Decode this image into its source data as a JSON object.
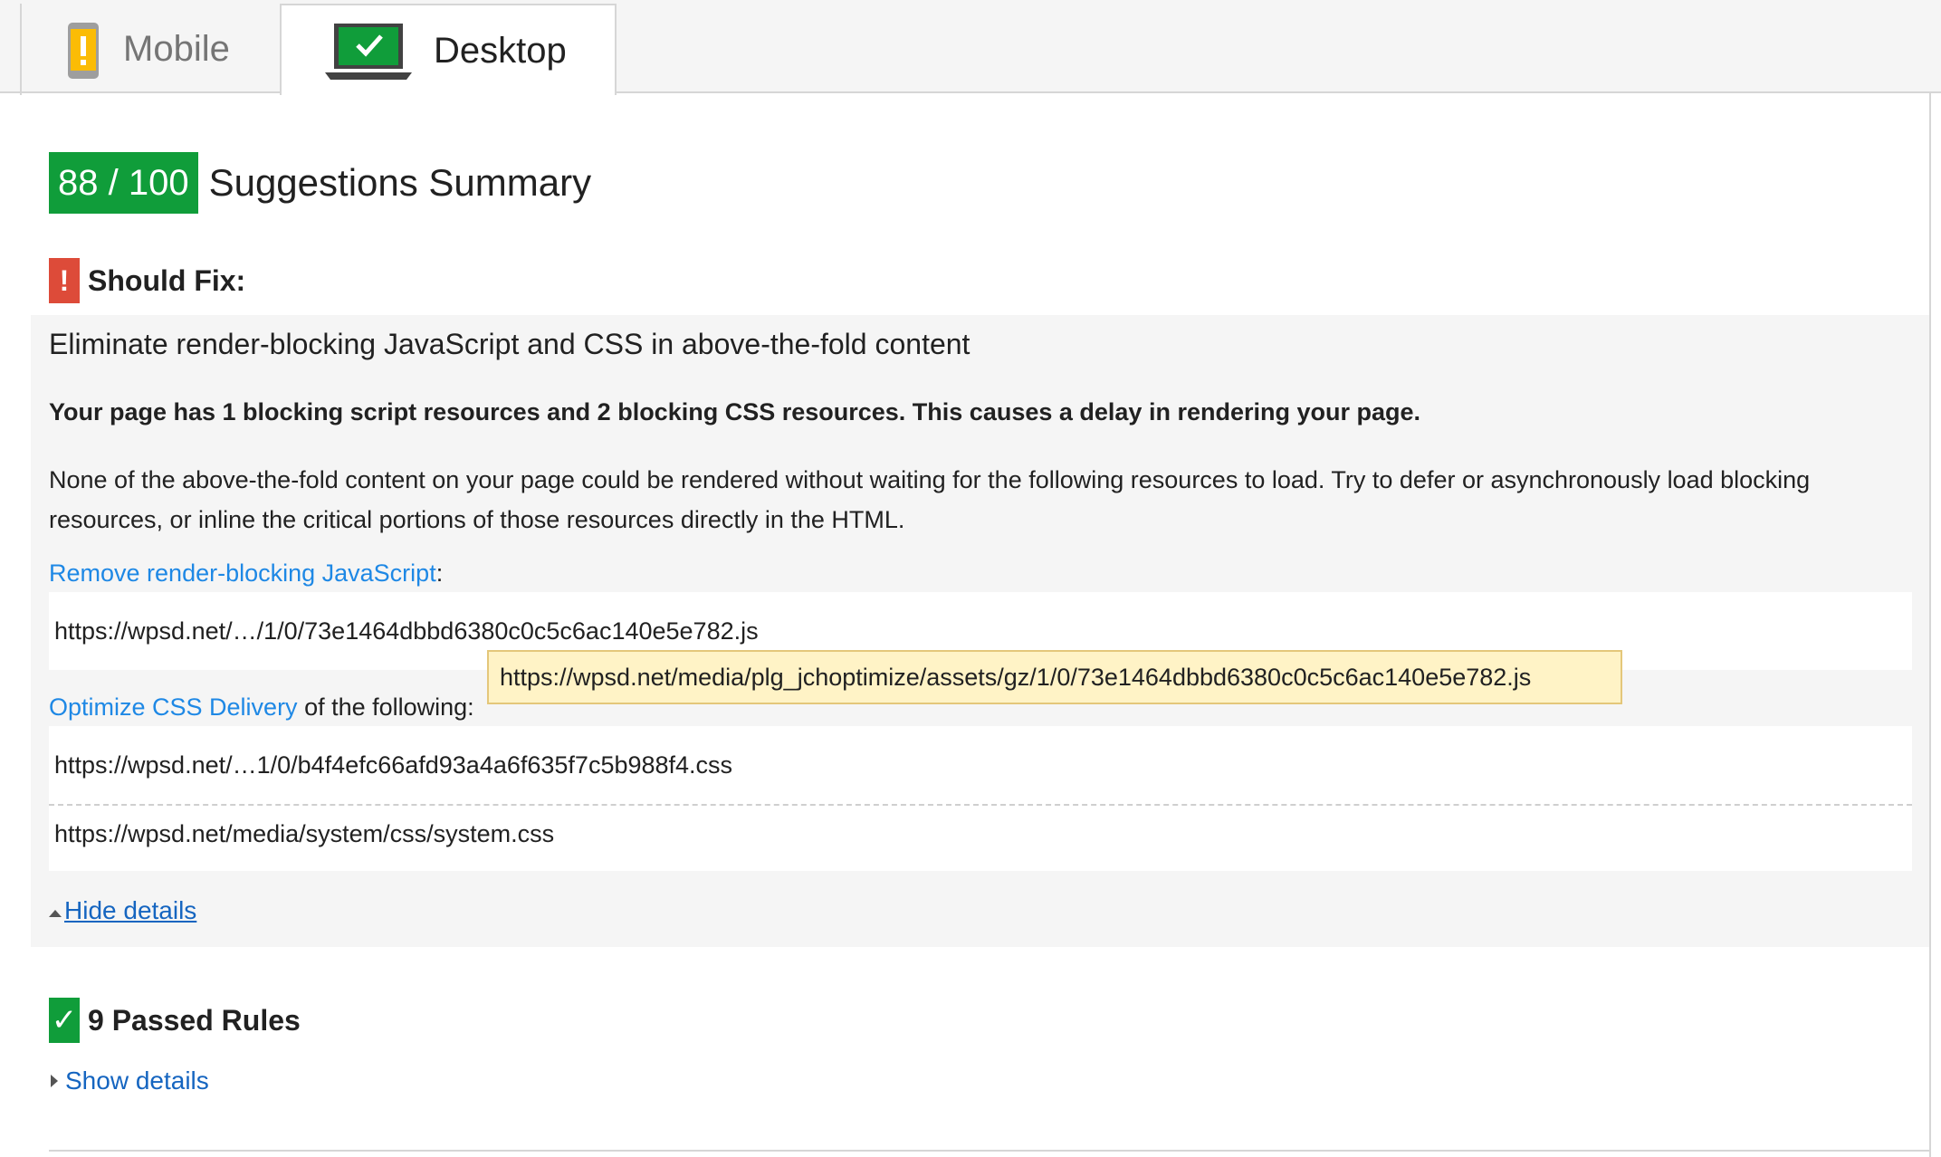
{
  "tabs": {
    "mobile_label": "Mobile",
    "desktop_label": "Desktop",
    "selected": "Desktop"
  },
  "summary": {
    "score": "88 / 100",
    "title": "Suggestions Summary"
  },
  "should_fix": {
    "icon_text": "!",
    "title": "Should Fix:",
    "rule": {
      "title": "Eliminate render-blocking JavaScript and CSS in above-the-fold content",
      "summary": "Your page has 1 blocking script resources and 2 blocking CSS resources. This causes a delay in rendering your page.",
      "description": "None of the above-the-fold content on your page could be rendered without waiting for the following resources to load. Try to defer or asynchronously load blocking resources, or inline the critical portions of those resources directly in the HTML.",
      "js_link": "Remove render-blocking JavaScript",
      "js_suffix": ":",
      "js_urls": [
        "https://wpsd.net/…/1/0/73e1464dbbd6380c0c5c6ac140e5e782.js"
      ],
      "css_link": "Optimize CSS Delivery",
      "css_suffix": " of the following:",
      "css_urls": [
        "https://wpsd.net/…1/0/b4f4efc66afd93a4a6f635f7c5b988f4.css",
        "https://wpsd.net/media/system/css/system.css"
      ],
      "tooltip": "https://wpsd.net/media/plg_jchoptimize/assets/gz/1/0/73e1464dbbd6380c0c5c6ac140e5e782.js",
      "hide_details": "Hide details"
    }
  },
  "passed": {
    "icon_text": "✓",
    "title": "9 Passed Rules",
    "show_details": "Show details"
  },
  "colors": {
    "score_green": "#109d3a",
    "fix_red": "#dd4b39",
    "link_blue": "#1e88e5",
    "tooltip_bg": "#fff3c6"
  }
}
